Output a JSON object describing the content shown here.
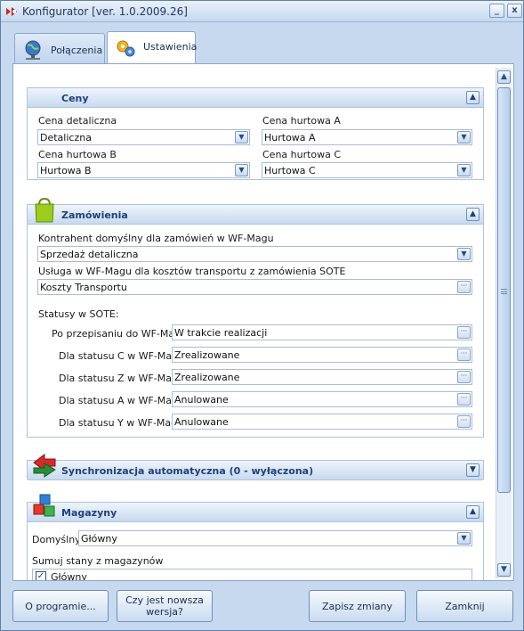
{
  "window": {
    "title": "Konfigurator [ver. 1.0.2009.26]",
    "minimize": "_",
    "close": "x"
  },
  "tabs": [
    {
      "label": "Połączenia",
      "icon": "globe-network-icon"
    },
    {
      "label": "Ustawienia",
      "icon": "gears-icon",
      "active": true
    }
  ],
  "ceny": {
    "title": "Ceny",
    "fields": [
      {
        "label": "Cena detaliczna",
        "value": "Detaliczna"
      },
      {
        "label": "Cena hurtowa A",
        "value": "Hurtowa A"
      },
      {
        "label": "Cena hurtowa B",
        "value": "Hurtowa B"
      },
      {
        "label": "Cena hurtowa C",
        "value": "Hurtowa C"
      }
    ]
  },
  "zamowienia": {
    "title": "Zamówienia",
    "contractor_label": "Kontrahent domyślny dla zamówień w WF-Magu",
    "contractor_value": "Sprzedaż detaliczna",
    "service_label": "Usługa w WF-Magu dla kosztów transportu z zamówienia SOTE",
    "service_value": "Koszty Transportu",
    "statuses_heading": "Statusy w SOTE:",
    "statuses": [
      {
        "label": "Po przepisaniu do WF-Maga",
        "value": "W trakcie realizacji"
      },
      {
        "label": "Dla statusu C w WF-Magu",
        "value": "Zrealizowane"
      },
      {
        "label": "Dla statusu Z w WF-Magu",
        "value": "Zrealizowane"
      },
      {
        "label": "Dla statusu A w WF-Magu",
        "value": "Anulowane"
      },
      {
        "label": "Dla statusu Y w WF-Magu",
        "value": "Anulowane"
      }
    ]
  },
  "sync": {
    "title": "Synchronizacja automatyczna (0 - wyłączona)"
  },
  "magazyny": {
    "title": "Magazyny",
    "default_label": "Domyślny",
    "default_value": "Główny",
    "sum_label": "Sumuj stany z magazynów",
    "items": [
      {
        "label": "Główny",
        "checked": true
      }
    ]
  },
  "footer": {
    "about": "O programie...",
    "update_line1": "Czy jest nowsza",
    "update_line2": "wersja?",
    "save": "Zapisz zmiany",
    "close": "Zamknij"
  },
  "colors": {
    "accent": "#20407b",
    "window_bg": "#c6d9ef",
    "group_header": "#c8daef"
  }
}
